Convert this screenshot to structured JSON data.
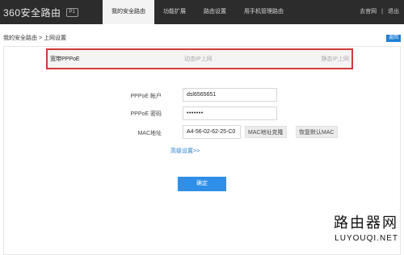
{
  "header": {
    "brand": "360安全路由",
    "brand_badge": "P1",
    "nav": [
      {
        "label": "我的安全路由",
        "active": true
      },
      {
        "label": "功能扩展",
        "active": false
      },
      {
        "label": "路由设置",
        "active": false
      },
      {
        "label": "用手机管理路由",
        "active": false
      }
    ],
    "right_links": [
      "去官网",
      "|",
      "退出"
    ]
  },
  "breadcrumb": "我的安全路由 > 上网设置",
  "back_button": "返回",
  "tabs": [
    {
      "label": "宽带PPPoE",
      "active": true
    },
    {
      "label": "动态IP上网",
      "active": false
    },
    {
      "label": "静态IP上网",
      "active": false
    }
  ],
  "form": {
    "account_label": "PPPoE 帐户",
    "account_value": "dsl6565651",
    "password_label": "PPPoE 密码",
    "password_value": "•••••••",
    "mac_label": "MAC地址",
    "mac_value": "A4-56-02-62-25-C0",
    "mac_clone_button": "MAC地址克隆",
    "mac_restore_button": "恢复默认MAC",
    "advanced_link": "高级设置>>",
    "confirm_button": "确定"
  },
  "watermark": {
    "cn": "路由器网",
    "en": "LUYOUQI.NET"
  },
  "colors": {
    "topbar": "#2c2c2c",
    "accent": "#2f8fe8",
    "tab_highlight": "#d23a3a"
  }
}
